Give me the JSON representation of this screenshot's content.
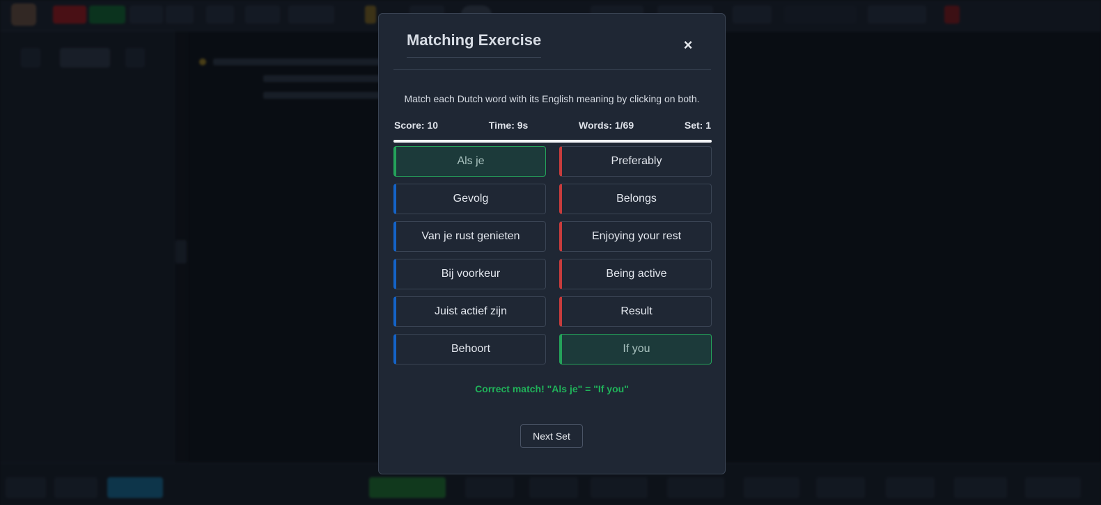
{
  "modal": {
    "title": "Matching Exercise",
    "close_icon": "×",
    "instructions": "Match each Dutch word with its English meaning by clicking on both.",
    "stats": {
      "score": "Score: 10",
      "time": "Time: 9s",
      "words": "Words: 1/69",
      "set": "Set: 1"
    },
    "progress": 1.0,
    "dutch_words": [
      "Als je",
      "Gevolg",
      "Van je rust genieten",
      "Bij voorkeur",
      "Juist actief zijn",
      "Behoort"
    ],
    "english_words": [
      "Preferably",
      "Belongs",
      "Enjoying your rest",
      "Being active",
      "Result",
      "If you"
    ],
    "matched": {
      "dutch": "Als je",
      "english": "If you"
    },
    "feedback": "Correct match! \"Als je\" = \"If you\"",
    "next_button": "Next Set"
  },
  "colors": {
    "dutch_accent": "#1463c7",
    "english_accent": "#c83c3c",
    "matched": "#24a25a",
    "feedback": "#20b35a"
  }
}
